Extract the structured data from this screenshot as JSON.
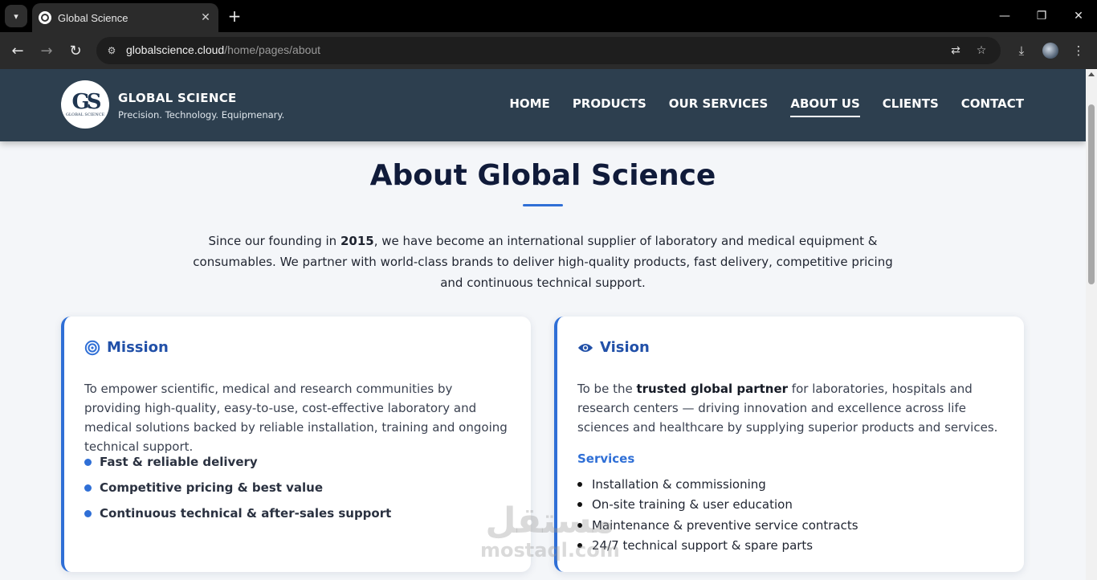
{
  "browser": {
    "tab_title": "Global Science",
    "url_host": "globalscience.cloud",
    "url_path": "/home/pages/about"
  },
  "site": {
    "brand_name": "GLOBAL SCIENCE",
    "tagline": "Precision. Technology. Equipmenary.",
    "logo_mark": "GS",
    "logo_small": "GLOBAL SCIENCE",
    "nav": {
      "home": "HOME",
      "products": "PRODUCTS",
      "services": "OUR SERVICES",
      "about": "ABOUT US",
      "clients": "CLIENTS",
      "contact": "CONTACT"
    },
    "active_nav": "about"
  },
  "about": {
    "title": "About Global Science",
    "intro_before": "Since our founding in ",
    "intro_year": "2015",
    "intro_after": ", we have become an international supplier of laboratory and medical equipment & consumables. We partner with world-class brands to deliver high-quality products, fast delivery, competitive pricing and continuous technical support."
  },
  "mission": {
    "heading": "Mission",
    "icon": "target-icon",
    "text": "To empower scientific, medical and research communities by providing high-quality, easy-to-use, cost-effective laboratory and medical solutions backed by reliable installation, training and ongoing technical support.",
    "points": [
      "Fast & reliable delivery",
      "Competitive pricing & best value",
      "Continuous technical & after-sales support"
    ]
  },
  "vision": {
    "heading": "Vision",
    "icon": "eye-icon",
    "text_before": "To be the ",
    "text_bold": "trusted global partner",
    "text_after": " for laboratories, hospitals and research centers — driving innovation and excellence across life sciences and healthcare by supplying superior products and services.",
    "services_heading": "Services",
    "services": [
      "Installation & commissioning",
      "On-site training & user education",
      "Maintenance & preventive service contracts",
      "24/7 technical support & spare parts"
    ]
  },
  "watermark": {
    "arabic": "مستقل",
    "latin": "mostaql.com"
  },
  "colors": {
    "header_bg": "#2d3f4f",
    "accent": "#2f6fd6",
    "title": "#101b3a"
  }
}
